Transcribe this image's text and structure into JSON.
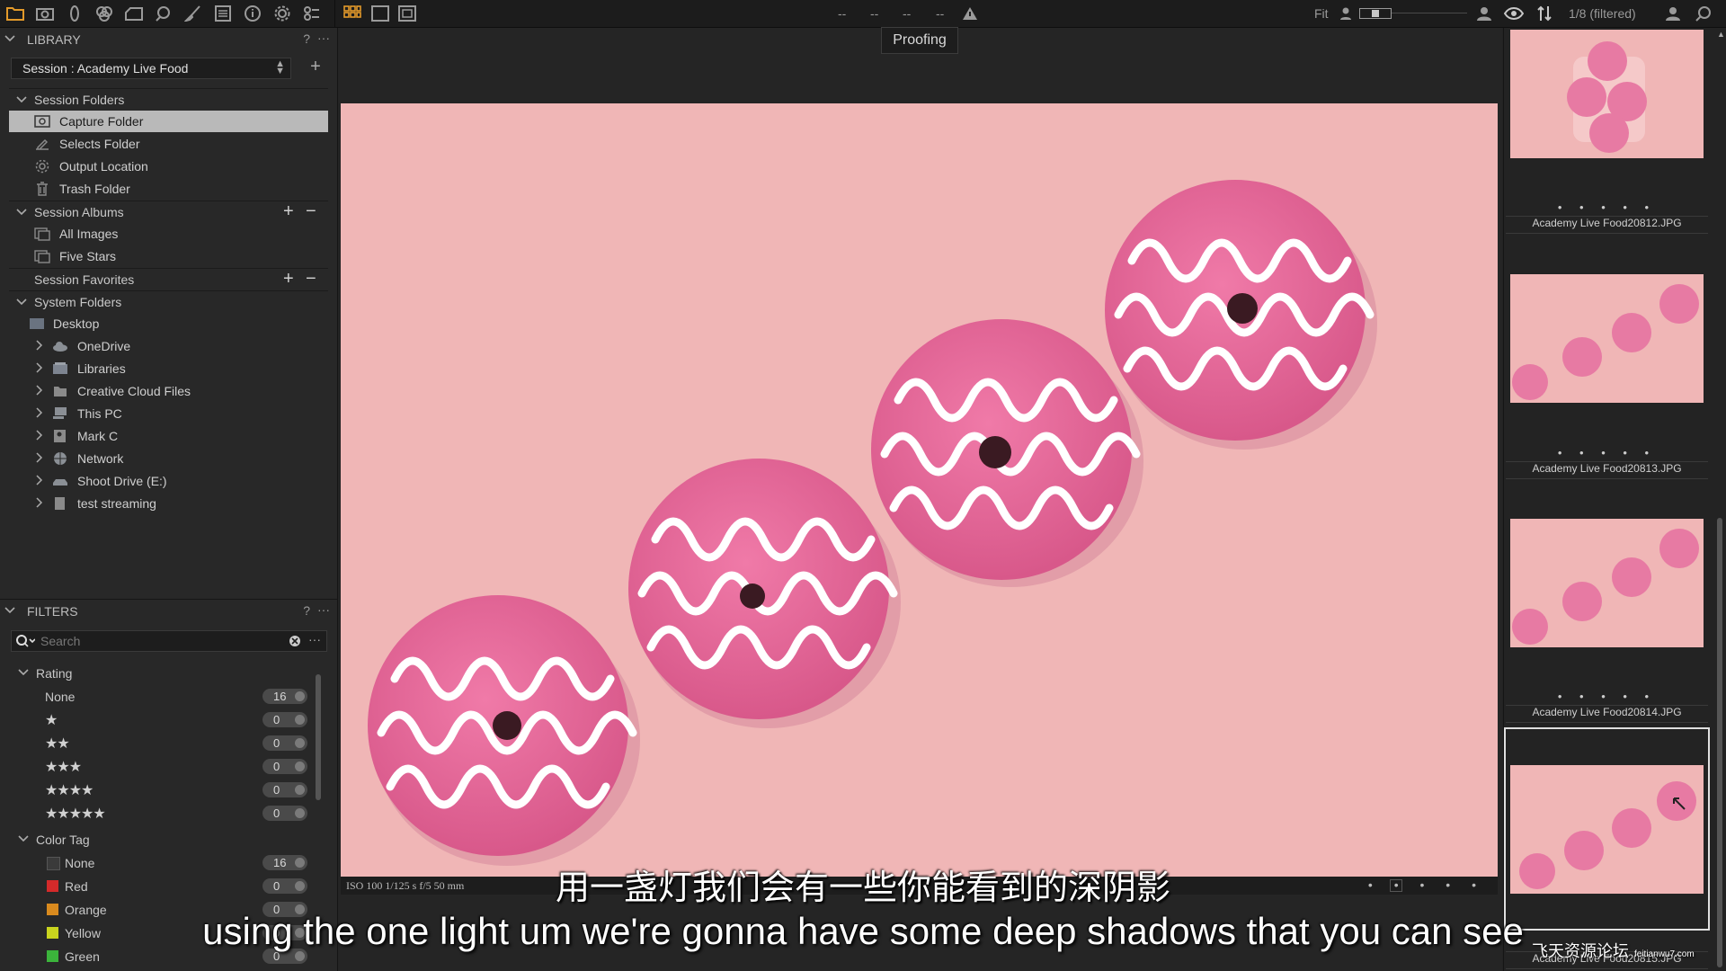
{
  "toolbar": {
    "left_icons": [
      "folder-icon",
      "camera-icon",
      "lens-icon",
      "color-icon",
      "exposure-icon",
      "search-zoom-icon",
      "brush-icon",
      "details-icon",
      "info-icon",
      "settings-icon",
      "batch-icon"
    ],
    "view_icons": [
      "grid-view-icon",
      "single-view-icon",
      "multi-view-icon"
    ],
    "center_placeholders": [
      "--",
      "--",
      "--",
      "--"
    ],
    "fit_label": "Fit",
    "count_label": "1/8 (filtered)"
  },
  "library": {
    "title": "LIBRARY",
    "help": "?",
    "more": "···",
    "session_label": "Session :  Academy Live Food",
    "session_folders": {
      "title": "Session Folders",
      "items": [
        {
          "label": "Capture Folder",
          "icon": "capture-folder-icon",
          "selected": true
        },
        {
          "label": "Selects Folder",
          "icon": "selects-folder-icon"
        },
        {
          "label": "Output Location",
          "icon": "output-gear-icon"
        },
        {
          "label": "Trash Folder",
          "icon": "trash-icon"
        }
      ]
    },
    "session_albums": {
      "title": "Session Albums",
      "items": [
        {
          "label": "All Images",
          "icon": "album-icon"
        },
        {
          "label": "Five Stars",
          "icon": "album-icon"
        }
      ]
    },
    "session_favorites": {
      "title": "Session Favorites"
    },
    "system_folders": {
      "title": "System Folders",
      "items": [
        {
          "label": "Desktop",
          "icon": "desktop-icon"
        },
        {
          "label": "OneDrive",
          "icon": "cloud-icon"
        },
        {
          "label": "Libraries",
          "icon": "libraries-icon"
        },
        {
          "label": "Creative Cloud Files",
          "icon": "creative-cloud-icon"
        },
        {
          "label": "This PC",
          "icon": "pc-icon"
        },
        {
          "label": "Mark C",
          "icon": "user-folder-icon"
        },
        {
          "label": "Network",
          "icon": "network-icon"
        },
        {
          "label": "Shoot Drive (E:)",
          "icon": "drive-icon"
        },
        {
          "label": "test streaming",
          "icon": "folder-icon"
        }
      ]
    }
  },
  "filters": {
    "title": "FILTERS",
    "help": "?",
    "more": "···",
    "search_placeholder": "Search",
    "rating": {
      "title": "Rating",
      "rows": [
        {
          "label": "None",
          "stars": "",
          "count": "16"
        },
        {
          "label": "",
          "stars": "★",
          "count": "0"
        },
        {
          "label": "",
          "stars": "★★",
          "count": "0"
        },
        {
          "label": "",
          "stars": "★★★",
          "count": "0"
        },
        {
          "label": "",
          "stars": "★★★★",
          "count": "0"
        },
        {
          "label": "",
          "stars": "★★★★★",
          "count": "0"
        }
      ]
    },
    "color_tag": {
      "title": "Color Tag",
      "rows": [
        {
          "label": "None",
          "color": "#3a3a3a",
          "count": "16"
        },
        {
          "label": "Red",
          "color": "#d42a2a",
          "count": "0"
        },
        {
          "label": "Orange",
          "color": "#d98a1e",
          "count": "0"
        },
        {
          "label": "Yellow",
          "color": "#c9d41e",
          "count": "0"
        },
        {
          "label": "Green",
          "color": "#3bb43b",
          "count": "0"
        }
      ]
    }
  },
  "viewer": {
    "proofing_label": "Proofing",
    "meta_info": "ISO 100   1/125 s   f/5   50 mm",
    "rating_dots": "• • • • •"
  },
  "browser": {
    "thumbnails": [
      {
        "name": "Academy Live Food20812.JPG",
        "dots": "• • • • •"
      },
      {
        "name": "Academy Live Food20813.JPG",
        "dots": "• • • • •"
      },
      {
        "name": "Academy Live Food20814.JPG",
        "dots": "• • • • •"
      },
      {
        "name": "Academy Live Food20815.JPG",
        "dots": "• • • • •",
        "selected": true
      }
    ]
  },
  "subtitles": {
    "chinese": "用一盏灯我们会有一些你能看到的深阴影",
    "english": "using the one light um we're gonna have some deep shadows that you can see"
  },
  "watermark": {
    "text": "飞天资源论坛",
    "url": "feitianwu7.com"
  },
  "colors": {
    "accent": "#e39a2a",
    "photo_bg": "#f0b6b6",
    "donut": "#e86f9e",
    "icing": "#ffffff"
  }
}
